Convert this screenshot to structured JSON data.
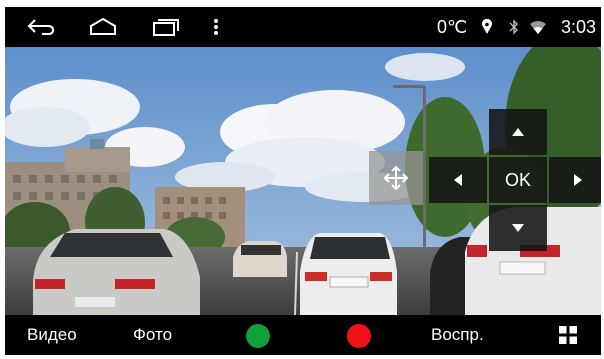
{
  "navigation": {
    "back_icon": "back-arrow-icon",
    "home_icon": "home-icon",
    "recents_icon": "recent-apps-icon",
    "menu_icon": "overflow-menu-icon"
  },
  "status": {
    "temperature": "0℃",
    "time": "3:03",
    "icons": [
      "location-icon",
      "bluetooth-icon",
      "wifi-icon"
    ]
  },
  "controls": {
    "ok_label": "OK",
    "move_icon": "move-arrows-icon"
  },
  "bottom_bar": {
    "video_label": "Видео",
    "photo_label": "Фото",
    "playback_label": "Воспр.",
    "green_button_color": "#0fa23a",
    "red_button_color": "#f2131a",
    "grid_icon": "grid-icon"
  }
}
